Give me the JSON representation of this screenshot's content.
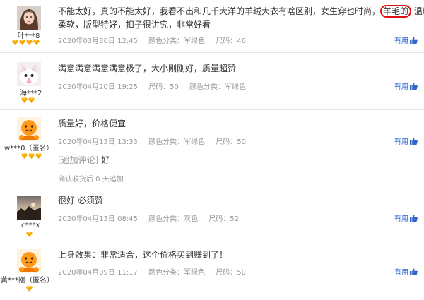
{
  "useful_label": "有用",
  "colors": {
    "useful": "#3366cc",
    "meta": "#999999",
    "diamond": "#f5a500",
    "highlight": "#e01010"
  },
  "reviews": [
    {
      "username": "叶***8",
      "avatar": "woman-portrait-avatar",
      "level_diamonds": 4,
      "text_line1_before": "不能太好，真的不能太好，我看不出和几千大洋的羊绒大衣有啥区别，女生穿也时尚，",
      "text_highlight": "羊毛的",
      "text_line1_after": "温暖",
      "text_line2": "柔软，版型特好，扣子很讲究，非常好看",
      "date": "2020年03月30日 12:45",
      "color_spec": "颜色分类：军绿色",
      "size_spec": "尺码：46"
    },
    {
      "username": "海***2",
      "avatar": "cat-avatar",
      "level_diamonds": 2,
      "text": "满意满意满意满意极了，大小刚刚好，质量超赞",
      "date": "2020年04月20日 19:25",
      "size_spec": "尺码：50",
      "color_spec": "颜色分类：军绿色"
    },
    {
      "username": "w***0（匿名）",
      "avatar": "anonymous-orange-avatar",
      "level_diamonds": 3,
      "text": "质量好，价格便宜",
      "date": "2020年04月13日 13:33",
      "color_spec": "颜色分类：军绿色",
      "size_spec": "尺码：50",
      "followup_label": "[追加评论]",
      "followup_text": "好",
      "followup_note": "确认收货后 0 天追加"
    },
    {
      "username": "c***x",
      "avatar": "sunset-avatar",
      "level_diamonds": 1,
      "text": "很好 必须赞",
      "date": "2020年04月13日 08:45",
      "color_spec": "颜色分类：灰色",
      "size_spec": "尺码：52"
    },
    {
      "username": "黄***刚（匿名）",
      "avatar": "anonymous-orange-avatar",
      "level_diamonds": 1,
      "text": "上身效果：非常适合，这个价格买到赚到了！",
      "date": "2020年04月09日 11:17",
      "color_spec": "颜色分类：军绿色",
      "size_spec": "尺码：50"
    }
  ]
}
